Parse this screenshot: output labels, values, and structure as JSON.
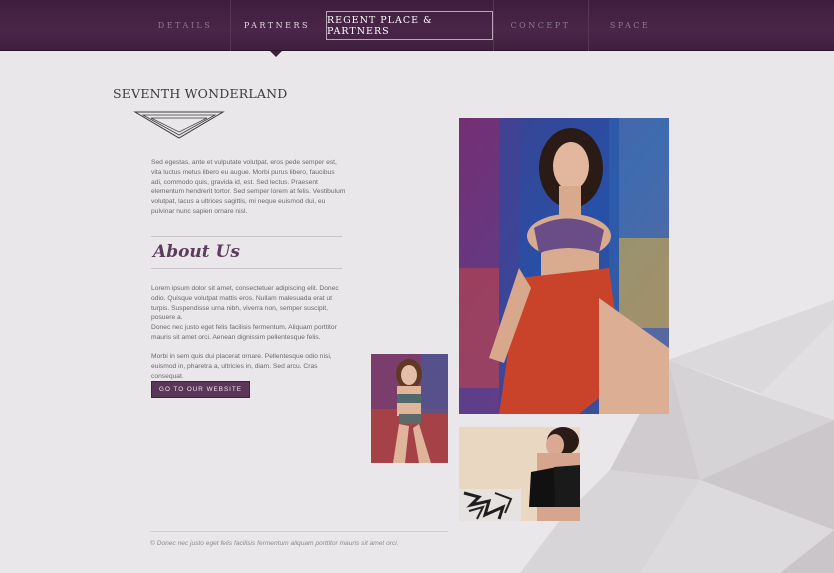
{
  "nav": {
    "items": [
      {
        "label": "DETAILS"
      },
      {
        "label": "PARTNERS"
      },
      {
        "label": "REGENT PLACE & PARTNERS"
      },
      {
        "label": "CONCEPT"
      },
      {
        "label": "SPACE"
      }
    ]
  },
  "logo": {
    "text": "SEVENTH WONDERLAND"
  },
  "intro": {
    "text": "Sed egestas, ante et vulputate volutpat, eros pede semper est, vita luctus metus libero eu augue. Morbi purus libero, faucibus adi, commodo quis, gravida id, est. Sed lectus. Praesent elementum hendrerit tortor. Sed semper lorem at felis. Vestibulum volutpat, lacus a ultrices sagittis, mi neque euismod dui, eu pulvinar nunc sapien ornare nisl."
  },
  "about": {
    "title": "About Us",
    "paragraphs": [
      "Lorem ipsum dolor sit amet, consectetuer adipiscing elit. Donec odio. Quisque volutpat mattis eros. Nullam malesuada erat ut turpis. Suspendisse urna nibh, viverra non, semper suscipit, posuere a.",
      "Donec nec justo eget felis facilisis fermentum. Aliquam porttitor mauris sit amet orci. Aenean dignissim pellentesque felis.",
      "Morbi in sem quis dui placerat ornare. Pellentesque odio nisi, euismod in, pharetra a, ultricies in, diam. Sed arcu. Cras consequat."
    ],
    "button_label": "GO TO OUR WEBSITE"
  },
  "footer": {
    "text": "© Donec nec justo eget felis facilisis fermentum aliquam porttitor mauris sit amet orci."
  },
  "colors": {
    "nav_bg": "#4a2649",
    "accent": "#5a3759",
    "page_bg": "#e9e7e9"
  }
}
